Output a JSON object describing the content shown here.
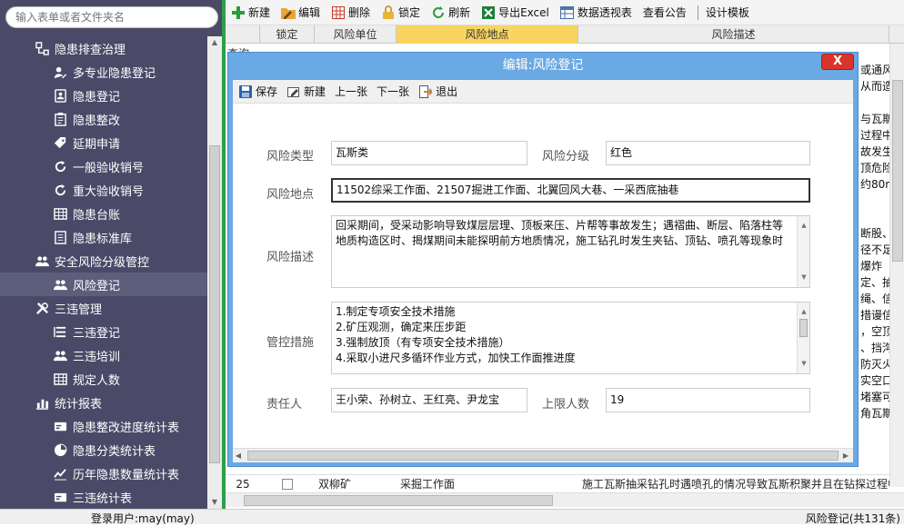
{
  "search": {
    "placeholder": "输入表单或者文件夹名"
  },
  "sidebar": {
    "items": [
      {
        "label": "隐患排查治理",
        "level": 1,
        "icon": "settings-tree-icon"
      },
      {
        "label": "多专业隐患登记",
        "level": 2,
        "icon": "person-edit-icon"
      },
      {
        "label": "隐患登记",
        "level": 2,
        "icon": "contact-card-icon"
      },
      {
        "label": "隐患整改",
        "level": 2,
        "icon": "clipboard-icon"
      },
      {
        "label": "延期申请",
        "level": 2,
        "icon": "tag-icon"
      },
      {
        "label": "一般验收销号",
        "level": 2,
        "icon": "refresh-icon"
      },
      {
        "label": "重大验收销号",
        "level": 2,
        "icon": "refresh-icon"
      },
      {
        "label": "隐患台账",
        "level": 2,
        "icon": "table-icon"
      },
      {
        "label": "隐患标准库",
        "level": 2,
        "icon": "document-icon"
      },
      {
        "label": "安全风险分级管控",
        "level": 1,
        "icon": "users-icon"
      },
      {
        "label": "风险登记",
        "level": 2,
        "icon": "users-icon",
        "active": true
      },
      {
        "label": "三违管理",
        "level": 1,
        "icon": "tools-icon"
      },
      {
        "label": "三违登记",
        "level": 2,
        "icon": "list-icon"
      },
      {
        "label": "三违培训",
        "level": 2,
        "icon": "users-icon"
      },
      {
        "label": "规定人数",
        "level": 2,
        "icon": "table-icon"
      },
      {
        "label": "统计报表",
        "level": 1,
        "icon": "bar-chart-icon"
      },
      {
        "label": "隐患整改进度统计表",
        "level": 2,
        "icon": "card-icon"
      },
      {
        "label": "隐患分类统计表",
        "level": 2,
        "icon": "pie-chart-icon"
      },
      {
        "label": "历年隐患数量统计表",
        "level": 2,
        "icon": "line-chart-icon"
      },
      {
        "label": "三违统计表",
        "level": 2,
        "icon": "card-icon"
      }
    ]
  },
  "toolbar": {
    "new": "新建",
    "edit": "编辑",
    "delete": "删除",
    "lock": "锁定",
    "refresh": "刷新",
    "export": "导出Excel",
    "pivot": "数据透视表",
    "notice": "查看公告",
    "design": "设计模板"
  },
  "grid": {
    "columns": [
      "锁定",
      "风险单位",
      "风险地点",
      "风险描述"
    ],
    "selected_column": "风险地点",
    "stub_label": "查询",
    "right_fragments": [
      "或通风",
      "从而造",
      "",
      "与瓦斯",
      "过程中",
      "故发生",
      "顶危险",
      "约80m",
      "",
      "",
      "断股、",
      "径不足",
      "爆炸",
      "定、抽",
      "绳、信",
      "措谩信",
      "，空顶",
      "、挡沟",
      "防灭火",
      "实空口",
      "堵塞可",
      "角瓦斯"
    ],
    "row25": {
      "number": "25",
      "unit": "双柳矿",
      "location": "采掘工作面",
      "description": "施工瓦斯抽采钻孔时遇喷孔的情况导致瓦斯积聚并且在钻探过程中"
    }
  },
  "modal": {
    "title": "编辑:风险登记",
    "close_label": "X",
    "toolbar": {
      "save": "保存",
      "new": "新建",
      "prev": "上一张",
      "next": "下一张",
      "exit": "退出"
    },
    "fields": {
      "risk_type_label": "风险类型",
      "risk_type_value": "瓦斯类",
      "risk_level_label": "风险分级",
      "risk_level_value": "红色",
      "location_label": "风险地点",
      "location_value": "11502综采工作面、21507掘进工作面、北翼回风大巷、一采西底抽巷",
      "description_label": "风险描述",
      "description_value": "回采期间，受采动影响导致煤层层理、顶板来压、片帮等事故发生；遇褶曲、断层、陷落柱等地质构造区时、揭煤期间未能探明前方地质情况，施工钻孔时发生夹钻、顶钻、喷孔等现象时",
      "measures_label": "管控措施",
      "measures_lines": [
        "1.制定专项安全技术措施",
        "2.矿压观测，确定来压步距",
        "3.强制放顶（有专项安全技术措施）",
        "4.采取小进尺多循环作业方式，加快工作面推进度"
      ],
      "responsible_label": "责任人",
      "responsible_value": "王小荣、孙树立、王红亮、尹龙宝",
      "max_people_label": "上限人数",
      "max_people_value": "19"
    }
  },
  "status": {
    "user": "登录用户:may(may)",
    "count": "风险登记(共131条)"
  },
  "colors": {
    "sidebar_bg": "#4a4a68",
    "splitter": "#2e9e4a",
    "modal_frame": "#6aa9e3",
    "selected_column": "#f8d55e",
    "close_button": "#d9342b"
  }
}
